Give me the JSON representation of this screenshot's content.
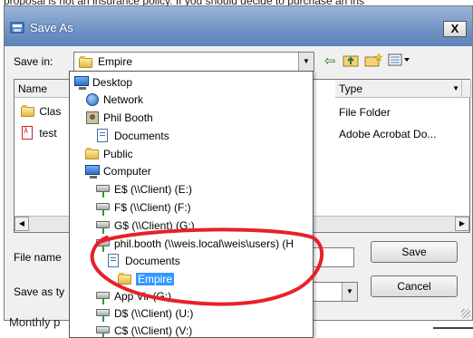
{
  "document": {
    "top_text": "proposal is not an insurance policy. If you should decide to purchase an ins",
    "bottom_text": "Monthly p"
  },
  "dialog": {
    "title": "Save As",
    "close_label": "X",
    "save_in_label": "Save in:",
    "save_in_value": "Empire",
    "toolbar_icons": [
      "back-arrow-icon",
      "up-folder-icon",
      "new-folder-icon",
      "view-menu-icon"
    ],
    "columns": {
      "name": "Name",
      "type": "Type"
    },
    "rows": [
      {
        "name": "Clas",
        "type": "File Folder",
        "icon": "folder-icon"
      },
      {
        "name": "test",
        "type": "Adobe Acrobat Do...",
        "icon": "pdf-icon"
      }
    ],
    "file_name_label": "File name",
    "save_as_type_label": "Save as ty",
    "save_button": "Save",
    "cancel_button": "Cancel"
  },
  "dropdown": {
    "items": [
      {
        "label": "Desktop",
        "icon": "desktop-icon"
      },
      {
        "label": "Network",
        "icon": "network-icon"
      },
      {
        "label": "Phil Booth",
        "icon": "user-icon"
      },
      {
        "label": "Documents",
        "icon": "documents-icon"
      },
      {
        "label": "Public",
        "icon": "folder-icon"
      },
      {
        "label": "Computer",
        "icon": "computer-icon"
      },
      {
        "label": "E$ (\\\\Client) (E:)",
        "icon": "drive-icon"
      },
      {
        "label": "F$ (\\\\Client) (F:)",
        "icon": "drive-icon"
      },
      {
        "label": "G$ (\\\\Client) (G:)",
        "icon": "drive-icon"
      },
      {
        "label": "phil.booth (\\\\weis.local\\weis\\users) (H",
        "icon": "network-drive-icon"
      },
      {
        "label": "Documents",
        "icon": "documents-icon"
      },
      {
        "label": "Empire",
        "icon": "folder-icon",
        "selected": true
      },
      {
        "label": "App Vir (G:)",
        "icon": "drive-icon"
      },
      {
        "label": "D$ (\\\\Client) (U:)",
        "icon": "drive-icon"
      },
      {
        "label": "C$ (\\\\Client) (V:)",
        "icon": "drive-icon"
      }
    ]
  },
  "colors": {
    "titlebar": "#6f93c4",
    "selection": "#3399ff",
    "annotation_circle": "#e8202a"
  }
}
